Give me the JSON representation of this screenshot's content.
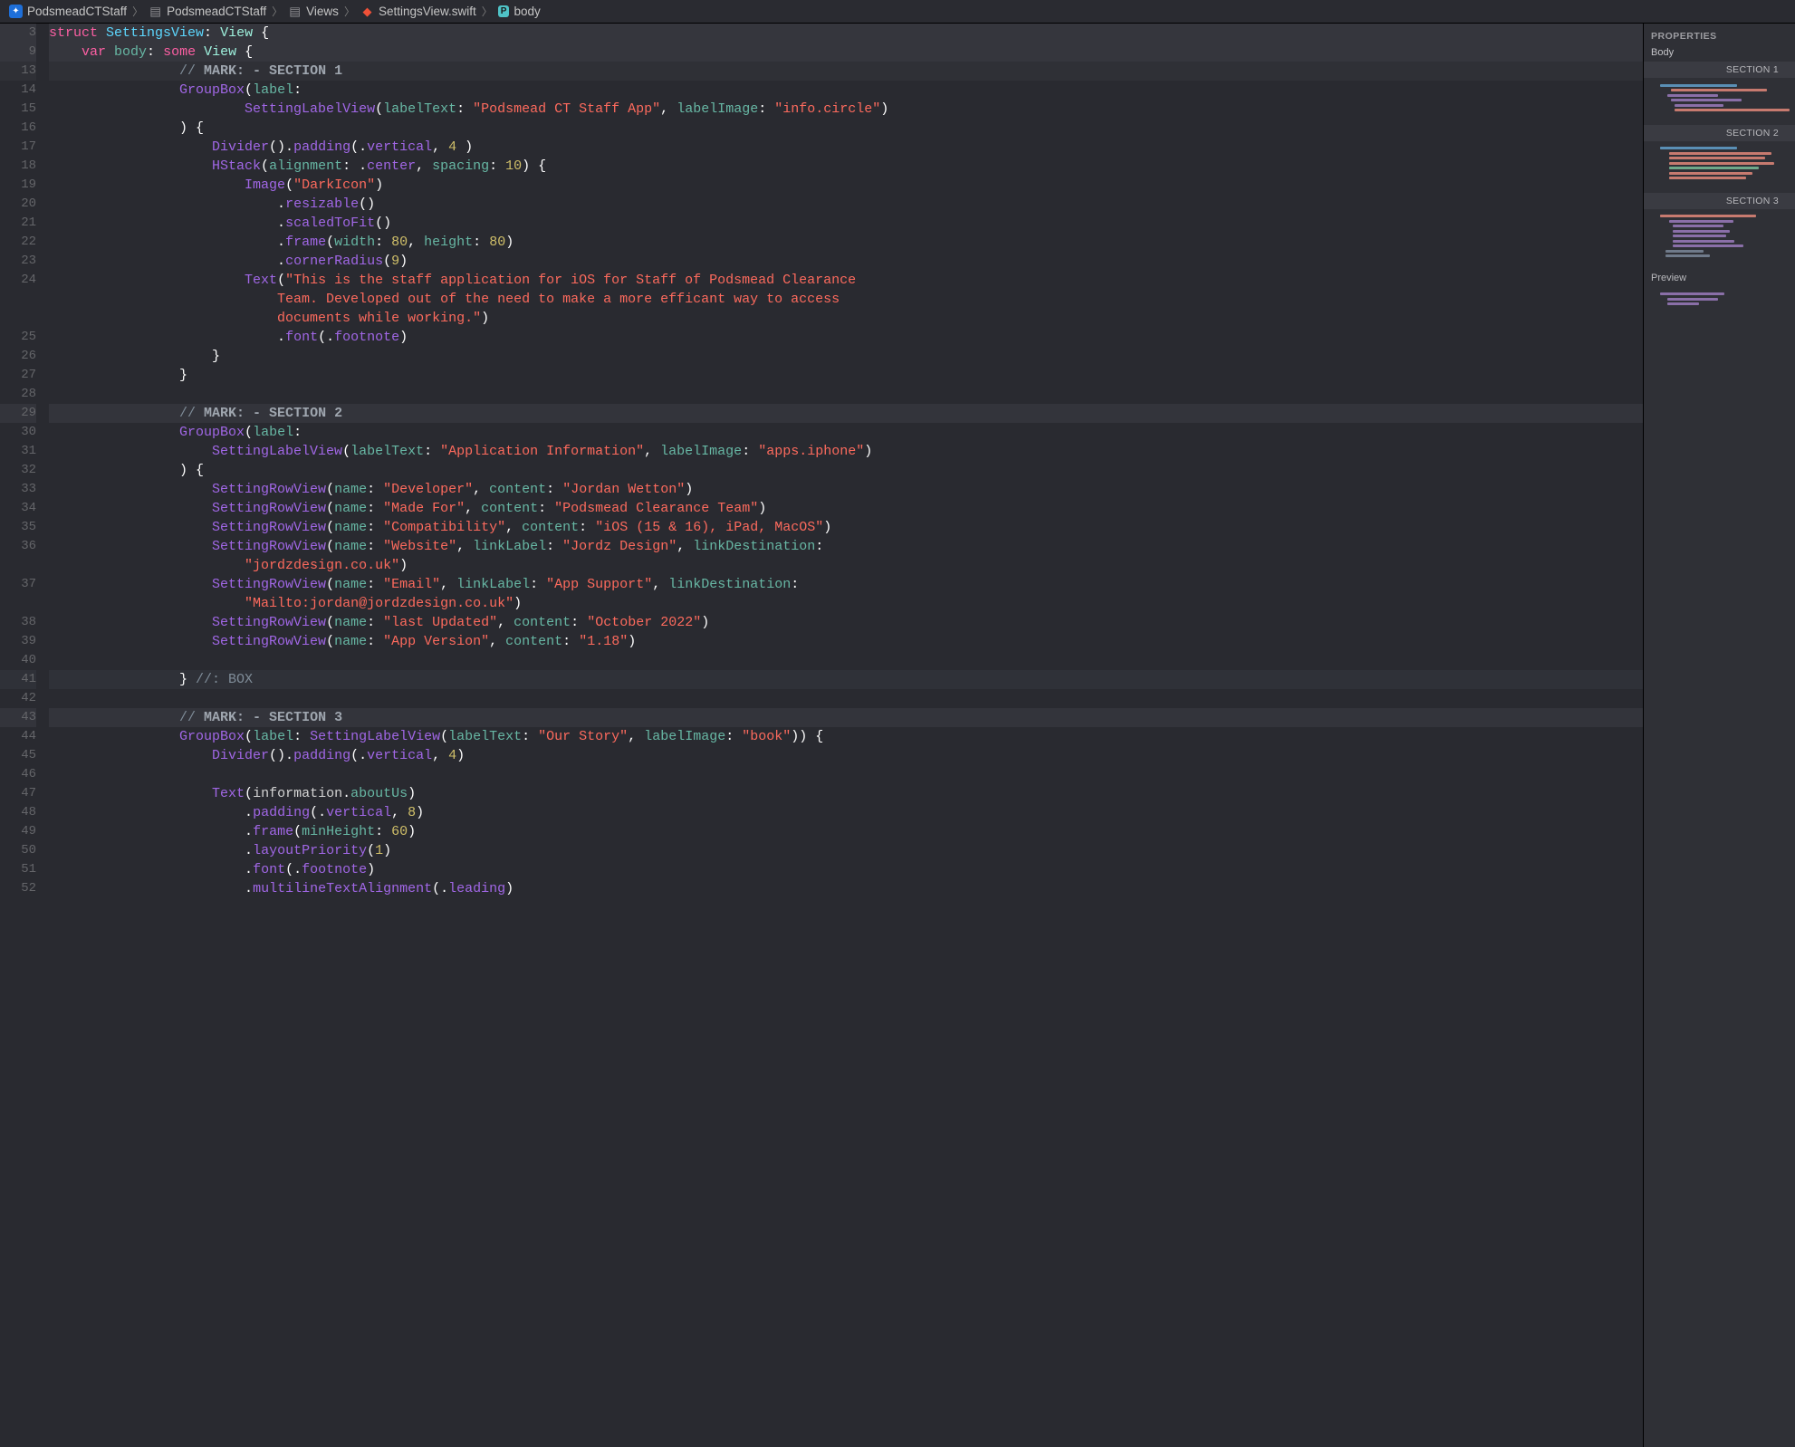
{
  "breadcrumb": {
    "app": "PodsmeadCTStaff",
    "folder": "PodsmeadCTStaff",
    "views": "Views",
    "file": "SettingsView.swift",
    "symbol": "body"
  },
  "minimap": {
    "properties": "PROPERTIES",
    "body": "Body",
    "section1": "SECTION 1",
    "section2": "SECTION 2",
    "section3": "SECTION 3",
    "preview": "Preview"
  },
  "code": {
    "l3": "struct SettingsView: View {",
    "l9": "    var body: some View {",
    "l13a": "                // MARK: - SECTION 1",
    "l14": "                GroupBox(label:",
    "l15": "                        SettingLabelView(labelText: \"Podsmead CT Staff App\", labelImage: \"info.circle\")",
    "l16": "                ) {",
    "l17": "                    Divider().padding(.vertical, 4 )",
    "l18": "                    HStack(alignment: .center, spacing: 10) {",
    "l19": "                        Image(\"DarkIcon\")",
    "l20": "                            .resizable()",
    "l21": "                            .scaledToFit()",
    "l22": "                            .frame(width: 80, height: 80)",
    "l23": "                            .cornerRadius(9)",
    "l24": "                        Text(\"This is the staff application for iOS for Staff of Podsmead Clearance Team. Developed out of the need to make a more efficant way to access documents while working.\")",
    "l25": "                            .font(.footnote)",
    "l26": "                    }",
    "l27": "                }",
    "l28": "",
    "l29": "                // MARK: - SECTION 2",
    "l30": "                GroupBox(label:",
    "l31": "                    SettingLabelView(labelText: \"Application Information\", labelImage: \"apps.iphone\")",
    "l32": "                ) {",
    "l33": "                    SettingRowView(name: \"Developer\", content: \"Jordan Wetton\")",
    "l34": "                    SettingRowView(name: \"Made For\", content: \"Podsmead Clearance Team\")",
    "l35": "                    SettingRowView(name: \"Compatibility\", content: \"iOS (15 & 16), iPad, MacOS\")",
    "l36": "                    SettingRowView(name: \"Website\", linkLabel: \"Jordz Design\", linkDestination: \"jordzdesign.co.uk\")",
    "l37": "                    SettingRowView(name: \"Email\", linkLabel: \"App Support\", linkDestination: \"Mailto:jordan@jordzdesign.co.uk\")",
    "l38": "                    SettingRowView(name: \"last Updated\", content: \"October 2022\")",
    "l39": "                    SettingRowView(name: \"App Version\", content: \"1.18\")",
    "l40": "",
    "l41": "                } //: BOX",
    "l42": "",
    "l43": "                // MARK: - SECTION 3",
    "l44": "                GroupBox(label: SettingLabelView(labelText: \"Our Story\", labelImage: \"book\")) {",
    "l45": "                    Divider().padding(.vertical, 4)",
    "l46": "",
    "l47": "                    Text(information.aboutUs)",
    "l48": "                        .padding(.vertical, 8)",
    "l49": "                        .frame(minHeight: 60)",
    "l50": "                        .layoutPriority(1)",
    "l51": "                        .font(.footnote)",
    "l52": "                        .multilineTextAlignment(.leading)"
  },
  "line_numbers": [
    "3",
    "9",
    "13",
    "14",
    "15",
    "16",
    "17",
    "18",
    "19",
    "20",
    "21",
    "22",
    "23",
    "24",
    "",
    "",
    "25",
    "26",
    "27",
    "28",
    "29",
    "30",
    "31",
    "32",
    "33",
    "34",
    "35",
    "36",
    "",
    "37",
    "",
    "38",
    "39",
    "40",
    "41",
    "42",
    "43",
    "44",
    "45",
    "46",
    "47",
    "48",
    "49",
    "50",
    "51",
    "52"
  ]
}
